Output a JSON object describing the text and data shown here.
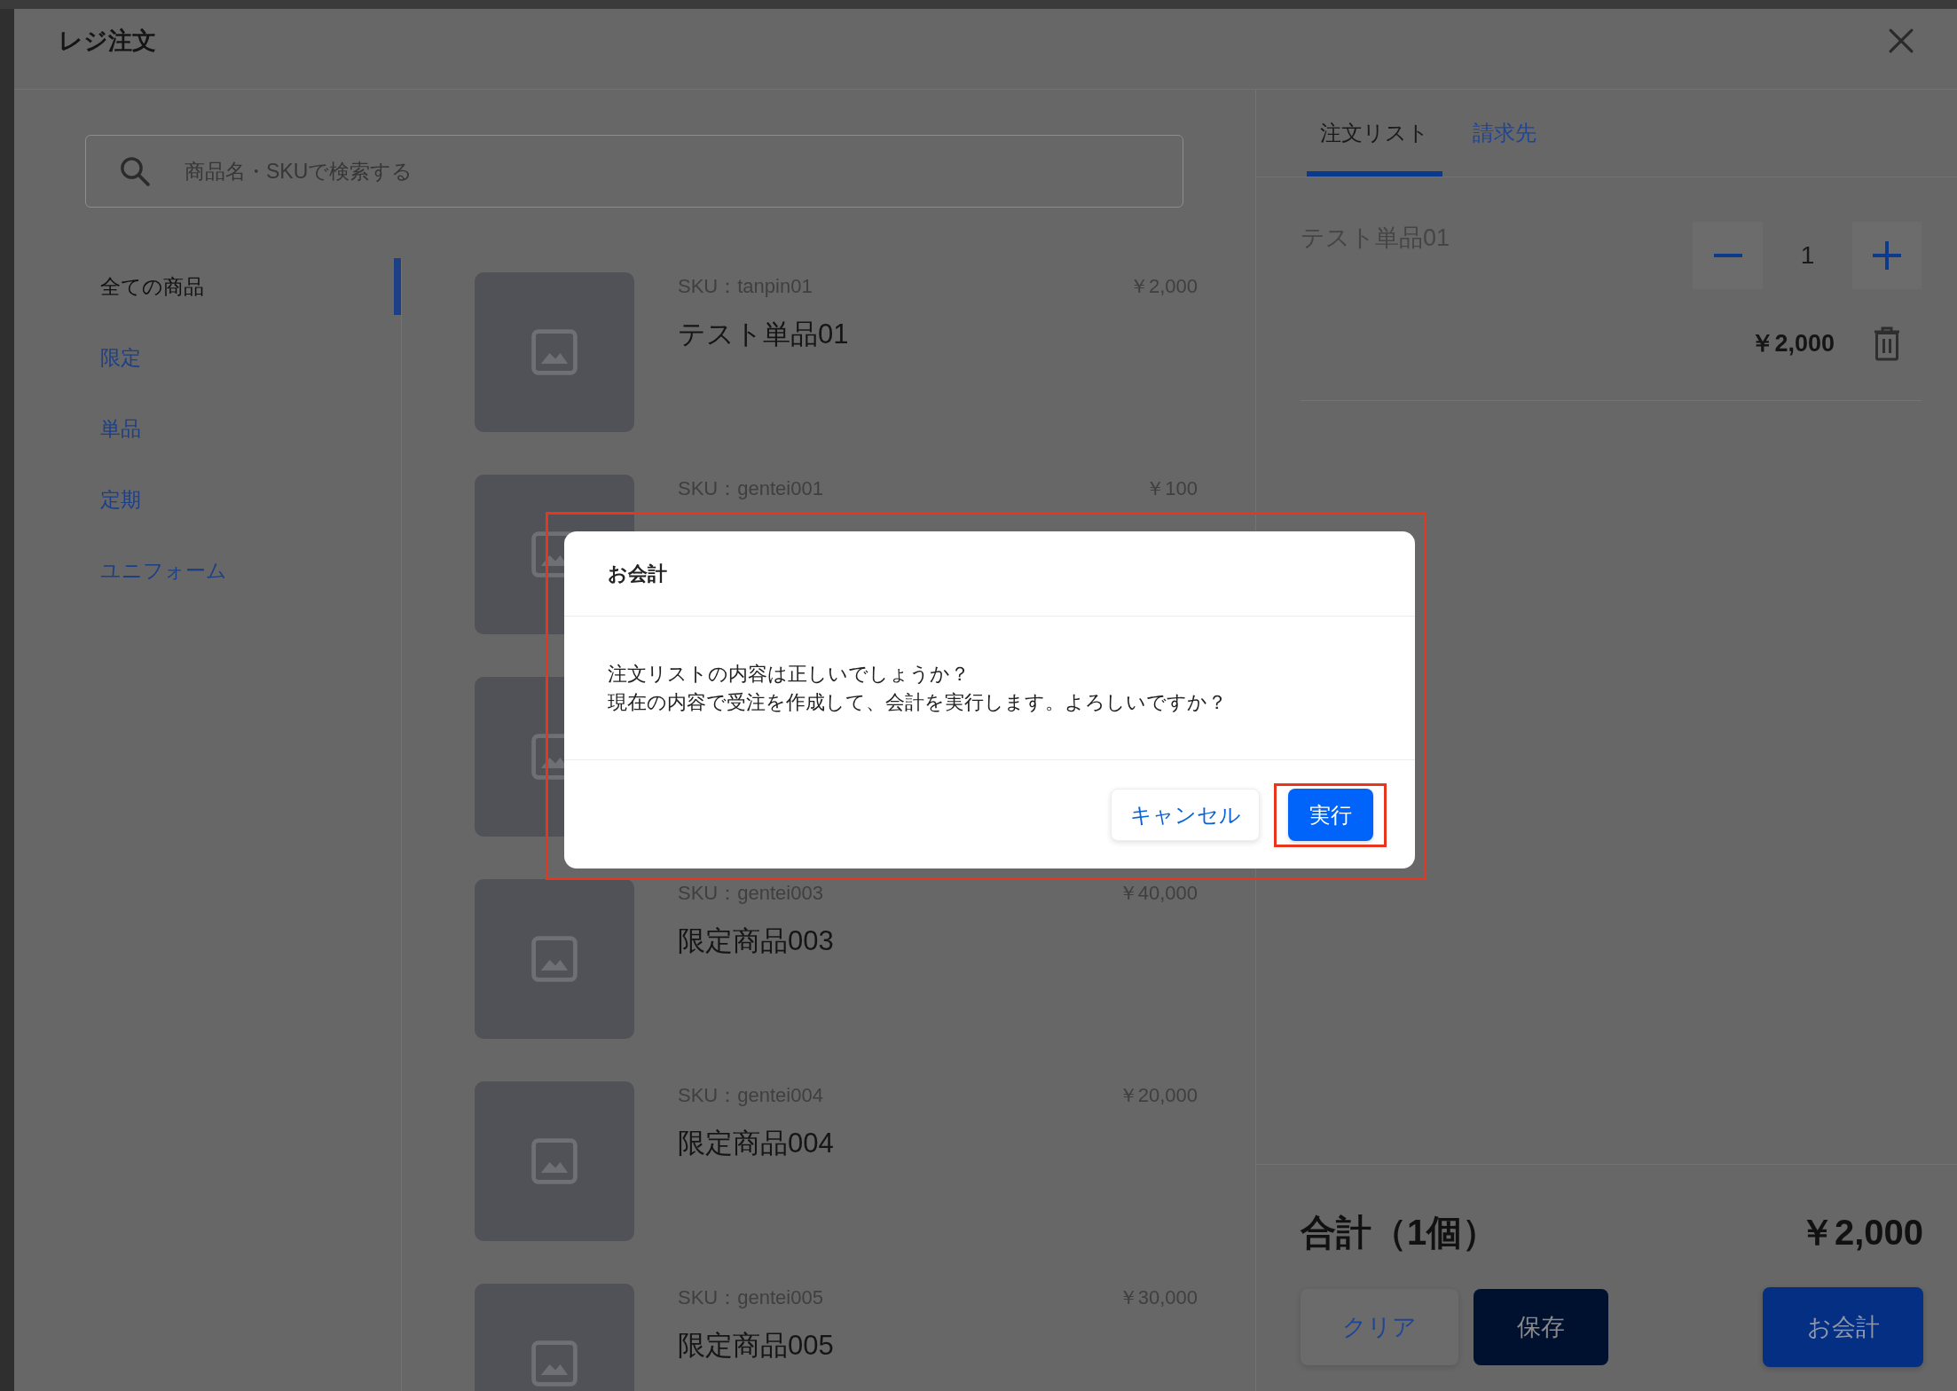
{
  "window": {
    "title": "レジ注文"
  },
  "search": {
    "placeholder": "商品名・SKUで検索する"
  },
  "categories": [
    {
      "label": "全ての商品",
      "selected": true
    },
    {
      "label": "限定",
      "selected": false
    },
    {
      "label": "単品",
      "selected": false
    },
    {
      "label": "定期",
      "selected": false
    },
    {
      "label": "ユニフォーム",
      "selected": false
    }
  ],
  "products": [
    {
      "image": true,
      "sku": "SKU：tanpin01",
      "price": "￥2,000",
      "name": "テスト単品01"
    },
    {
      "image": true,
      "sku": "SKU：gentei001",
      "price": "￥100"
    },
    {
      "image": true
    },
    {
      "image": true,
      "sku": "SKU：gentei003",
      "price": "￥40,000",
      "name": "限定商品003"
    },
    {
      "image": true,
      "sku": "SKU：gentei004",
      "price": "￥20,000",
      "name": "限定商品004"
    },
    {
      "image": true,
      "sku": "SKU：gentei005",
      "price": "￥30,000",
      "name": "限定商品005"
    }
  ],
  "tabs": [
    {
      "label": "注文リスト",
      "selected": true
    },
    {
      "label": "請求先",
      "selected": false
    }
  ],
  "order_items": [
    {
      "name": "テスト単品01",
      "quantity": "1",
      "price": "￥2,000"
    }
  ],
  "total": {
    "label": "合計（1個）",
    "amount": "￥2,000"
  },
  "actions": [
    {
      "label": "クリア",
      "kind": "secondary"
    },
    {
      "label": "保存",
      "kind": "dark"
    },
    {
      "label": "お会計",
      "kind": "primary"
    }
  ],
  "dialog": {
    "title": "お会計",
    "message_lines": [
      "注文リストの内容は正しいでしょうか？",
      "現在の内容で受注を作成して、会計を実行します。よろしいですか？"
    ],
    "highlighted": true,
    "buttons": [
      {
        "label": "キャンセル",
        "kind": "secondary",
        "highlighted": false
      },
      {
        "label": "実行",
        "kind": "primary",
        "highlighted": true
      }
    ]
  }
}
